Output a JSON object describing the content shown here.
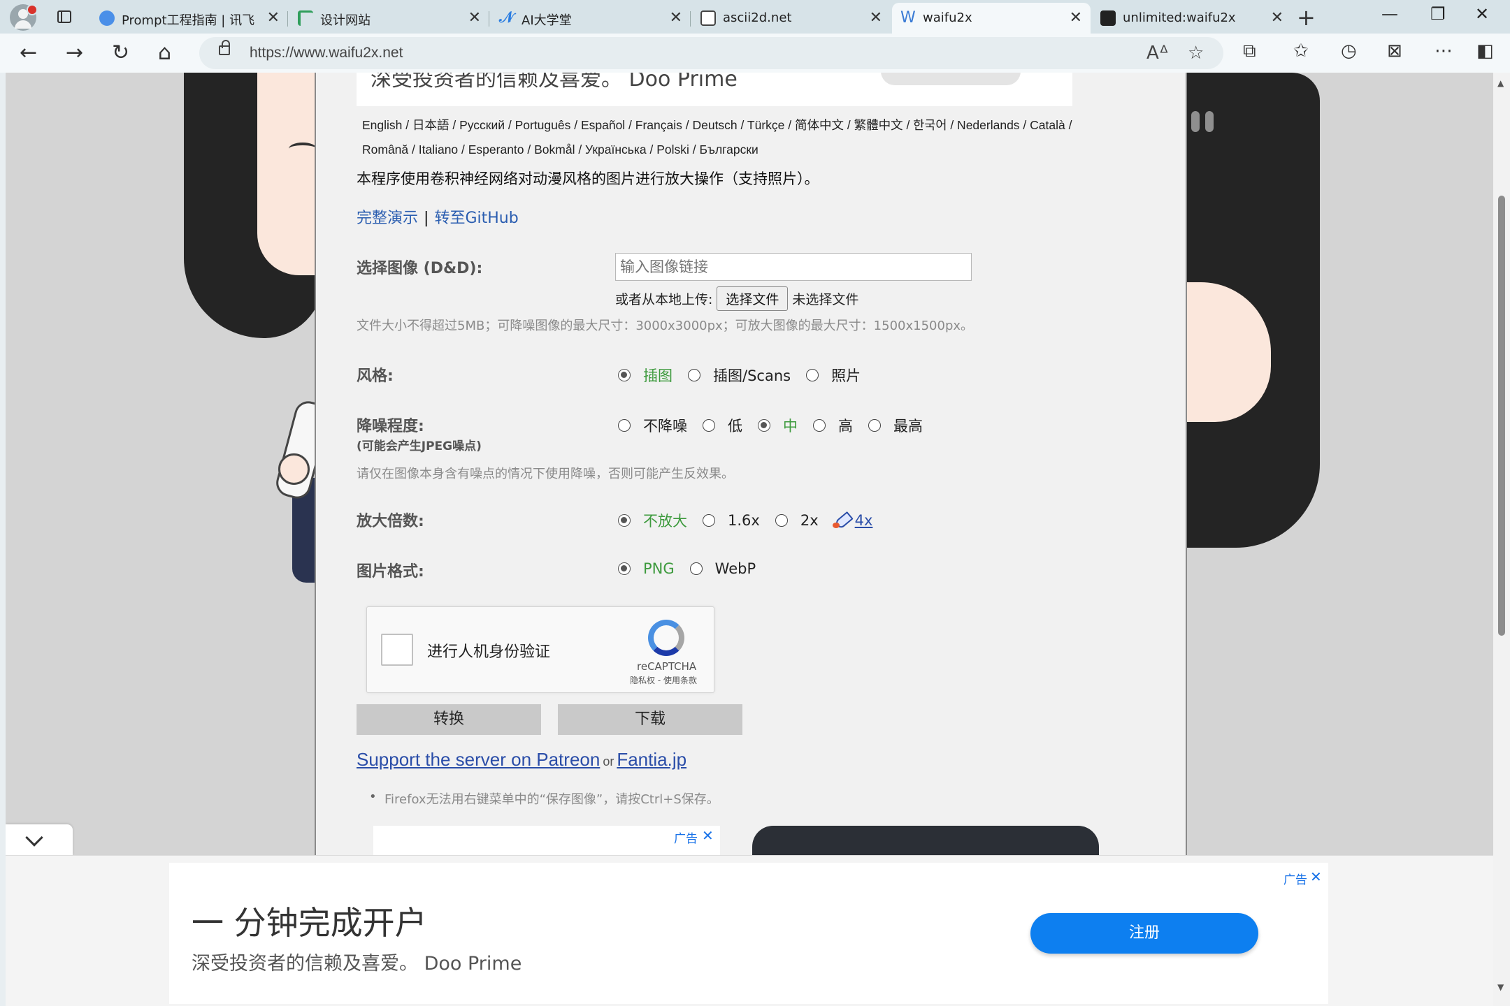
{
  "browser": {
    "tabs": [
      {
        "title": "Prompt工程指南 | 讯飞星火",
        "favicon": "spark-icon",
        "color": "#4a8fe8"
      },
      {
        "title": "设计网站",
        "favicon": "design-icon",
        "color": "#2f9e5b"
      },
      {
        "title": "AI大学堂",
        "favicon": "ai-icon",
        "color": "#2a7de1"
      },
      {
        "title": "ascii2d.net",
        "favicon": "ascii2d-icon",
        "color": "#444444"
      },
      {
        "title": "waifu2x",
        "favicon": "waifu2x-icon",
        "color": "#3a7bd5"
      },
      {
        "title": "unlimited:waifu2x",
        "favicon": "unlimited-icon",
        "color": "#222222"
      }
    ],
    "active_tab": 4,
    "url": "https://www.waifu2x.net"
  },
  "page": {
    "top_ad_text": "深受投资者的信赖及喜爱。 Doo Prime",
    "languages_line1": "English / 日本語 / Русский / Português / Español / Français / Deutsch / Türkçe / 简体中文 / 繁體中文 / 한국어 / Nederlands / Català /",
    "languages_line2": "Română / Italiano / Esperanto / Bokmål / Українська / Polski / Български",
    "description": "本程序使用卷积神经网络对动漫风格的图片进行放大操作（支持照片）。",
    "link_demo": "完整演示",
    "link_sep": "|",
    "link_github": "转至GitHub",
    "image_label": "选择图像 (D&D):",
    "url_placeholder": "输入图像链接",
    "upload_prefix": "或者从本地上传:",
    "file_button": "选择文件",
    "file_status": "未选择文件",
    "size_note": "文件大小不得超过5MB；可降噪图像的最大尺寸：3000x3000px；可放大图像的最大尺寸：1500x1500px。",
    "style_label": "风格:",
    "style_options": [
      "插图",
      "插图/Scans",
      "照片"
    ],
    "style_selected": 0,
    "noise_label": "降噪程度:",
    "noise_sublabel": "(可能会产生JPEG噪点)",
    "noise_options": [
      "不降噪",
      "低",
      "中",
      "高",
      "最高"
    ],
    "noise_selected": 2,
    "noise_note": "请仅在图像本身含有噪点的情况下使用降噪，否则可能产生反效果。",
    "scale_label": "放大倍数:",
    "scale_options": [
      "不放大",
      "1.6x",
      "2x",
      "4x"
    ],
    "scale_selected": 0,
    "format_label": "图片格式:",
    "format_options": [
      "PNG",
      "WebP"
    ],
    "format_selected": 0,
    "captcha_text": "进行人机身份验证",
    "captcha_brand": "reCAPTCHA",
    "captcha_terms": "隐私权 - 使用条款",
    "convert_button": "转换",
    "download_button": "下载",
    "patreon_link": "Support the server on Patreon",
    "or_text": "or",
    "fantia_link": "Fantia.jp",
    "firefox_tip": "Firefox无法用右键菜单中的“保存图像”，请按Ctrl+S保存。",
    "ad_label": "广告",
    "ad_close": "✕"
  },
  "bottom_ad": {
    "title": "一 分钟完成开户",
    "subtitle": "深受投资者的信赖及喜爱。 Doo Prime",
    "button": "注册",
    "label": "广告",
    "close": "✕"
  },
  "colors": {
    "selected_option": "#3d9a3d",
    "link": "#2a5db0",
    "register_button": "#0d7ff0"
  }
}
